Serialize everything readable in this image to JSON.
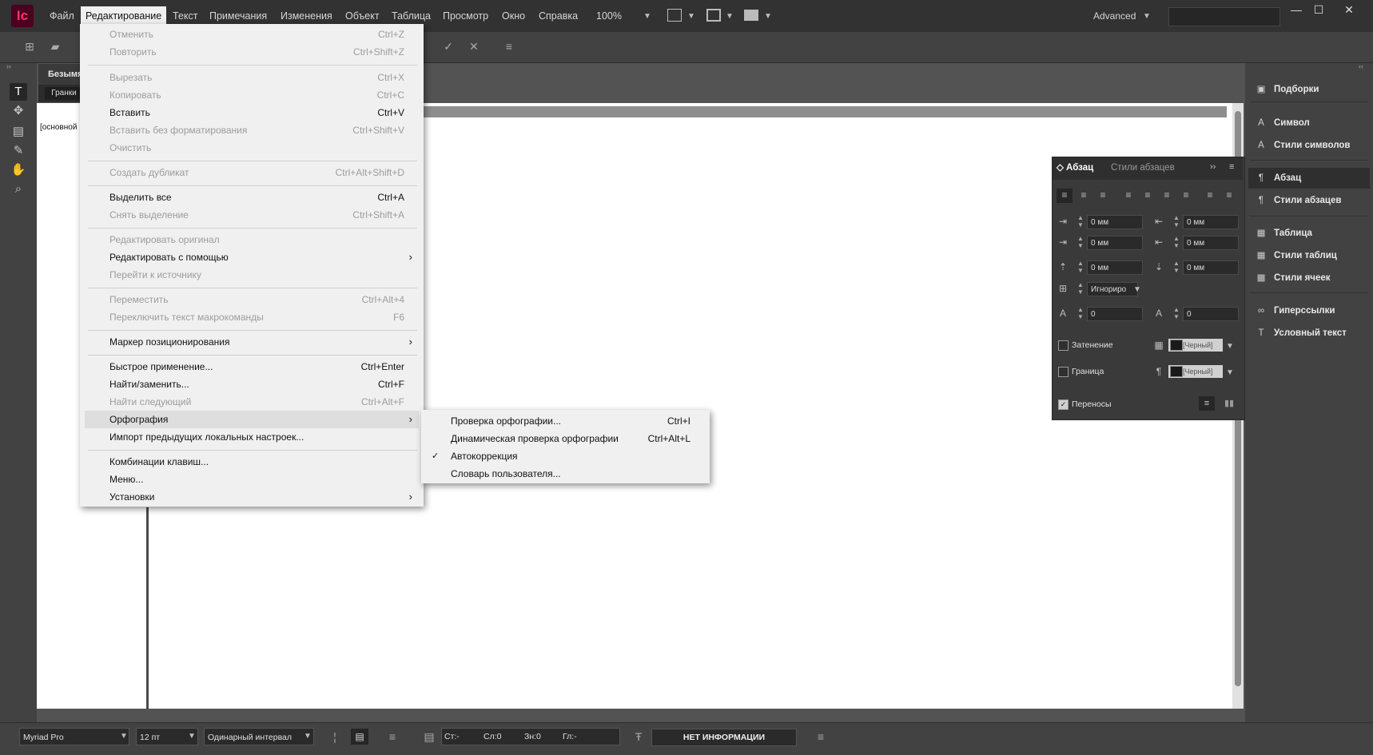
{
  "app": {
    "logo": "Ic",
    "workspace": "Advanced"
  },
  "menubar": {
    "items": [
      "Файл",
      "Редактирование",
      "Текст",
      "Примечания",
      "Изменения",
      "Объект",
      "Таблица",
      "Просмотр",
      "Окно",
      "Справка"
    ],
    "zoom": "100%"
  },
  "document": {
    "tab_title": "Безымя",
    "galley_tab": "Гранки",
    "base_style": "[основной"
  },
  "edit_menu": {
    "undo": {
      "label": "Отменить",
      "shortcut": "Ctrl+Z"
    },
    "redo": {
      "label": "Повторить",
      "shortcut": "Ctrl+Shift+Z"
    },
    "cut": {
      "label": "Вырезать",
      "shortcut": "Ctrl+X"
    },
    "copy": {
      "label": "Копировать",
      "shortcut": "Ctrl+C"
    },
    "paste": {
      "label": "Вставить",
      "shortcut": "Ctrl+V"
    },
    "paste_plain": {
      "label": "Вставить без форматирования",
      "shortcut": "Ctrl+Shift+V"
    },
    "clear": {
      "label": "Очистить"
    },
    "duplicate": {
      "label": "Создать дубликат",
      "shortcut": "Ctrl+Alt+Shift+D"
    },
    "select_all": {
      "label": "Выделить все",
      "shortcut": "Ctrl+A"
    },
    "deselect": {
      "label": "Снять выделение",
      "shortcut": "Ctrl+Shift+A"
    },
    "edit_original": {
      "label": "Редактировать оригинал"
    },
    "edit_with": {
      "label": "Редактировать с помощью"
    },
    "go_to_source": {
      "label": "Перейти к источнику"
    },
    "move": {
      "label": "Переместить",
      "shortcut": "Ctrl+Alt+4"
    },
    "toggle_macro": {
      "label": "Переключить текст макрокоманды",
      "shortcut": "F6"
    },
    "anchor_marker": {
      "label": "Маркер позиционирования"
    },
    "quick_apply": {
      "label": "Быстрое применение...",
      "shortcut": "Ctrl+Enter"
    },
    "find_replace": {
      "label": "Найти/заменить...",
      "shortcut": "Ctrl+F"
    },
    "find_next": {
      "label": "Найти следующий",
      "shortcut": "Ctrl+Alt+F"
    },
    "spelling": {
      "label": "Орфография"
    },
    "import_settings": {
      "label": "Импорт предыдущих локальных настроек..."
    },
    "shortcuts": {
      "label": "Комбинации клавиш..."
    },
    "menus": {
      "label": "Меню..."
    },
    "preferences": {
      "label": "Установки"
    }
  },
  "spelling_submenu": {
    "check": {
      "label": "Проверка орфографии...",
      "shortcut": "Ctrl+I"
    },
    "dynamic": {
      "label": "Динамическая проверка орфографии",
      "shortcut": "Ctrl+Alt+L"
    },
    "autocorrect": {
      "label": "Автокоррекция",
      "checkmark": "✓"
    },
    "dictionary": {
      "label": "Словарь пользователя..."
    }
  },
  "right_panel": {
    "items": [
      "Подборки",
      "Символ",
      "Стили символов",
      "Абзац",
      "Стили абзацев",
      "Таблица",
      "Стили таблиц",
      "Стили ячеек",
      "Гиперссылки",
      "Условный текст"
    ]
  },
  "paragraph_panel": {
    "tab_active": "Абзац",
    "tab_inactive": "Стили абзацев",
    "fields": [
      "0 мм",
      "0 мм",
      "0 мм",
      "0 мм",
      "0 мм",
      "0 мм"
    ],
    "align_grid": "Игнориро",
    "dropcap_lines": "0",
    "dropcap_chars": "0",
    "shading_label": "Затенение",
    "border_label": "Граница",
    "color_value": "[Черный]",
    "hyphenation_label": "Переносы"
  },
  "status_bar": {
    "font": "Myriad Pro",
    "size": "12 пт",
    "leading": "Одинарный интервал",
    "st": "Ст:-",
    "sl": "Сл:0",
    "zn": "Зн:0",
    "gl": "Гл:-",
    "info": "НЕТ ИНФОРМАЦИИ"
  }
}
